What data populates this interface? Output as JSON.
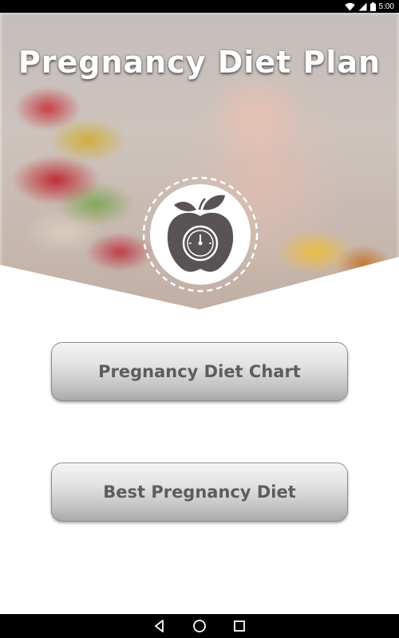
{
  "status_bar": {
    "time": "5:00",
    "icons": [
      "wifi-icon",
      "signal-icon",
      "battery-icon"
    ]
  },
  "hero": {
    "title": "Pregnancy Diet Plan",
    "logo_icon": "apple-scale-icon"
  },
  "menu": {
    "items": [
      {
        "label": "Pregnancy Diet Chart"
      },
      {
        "label": "Best Pregnancy Diet"
      }
    ]
  },
  "nav": {
    "icons": [
      "back-icon",
      "home-icon",
      "recents-icon"
    ]
  },
  "colors": {
    "button_text": "#5d5d5d",
    "button_border": "#8d8d8d",
    "background": "#ffffff"
  }
}
